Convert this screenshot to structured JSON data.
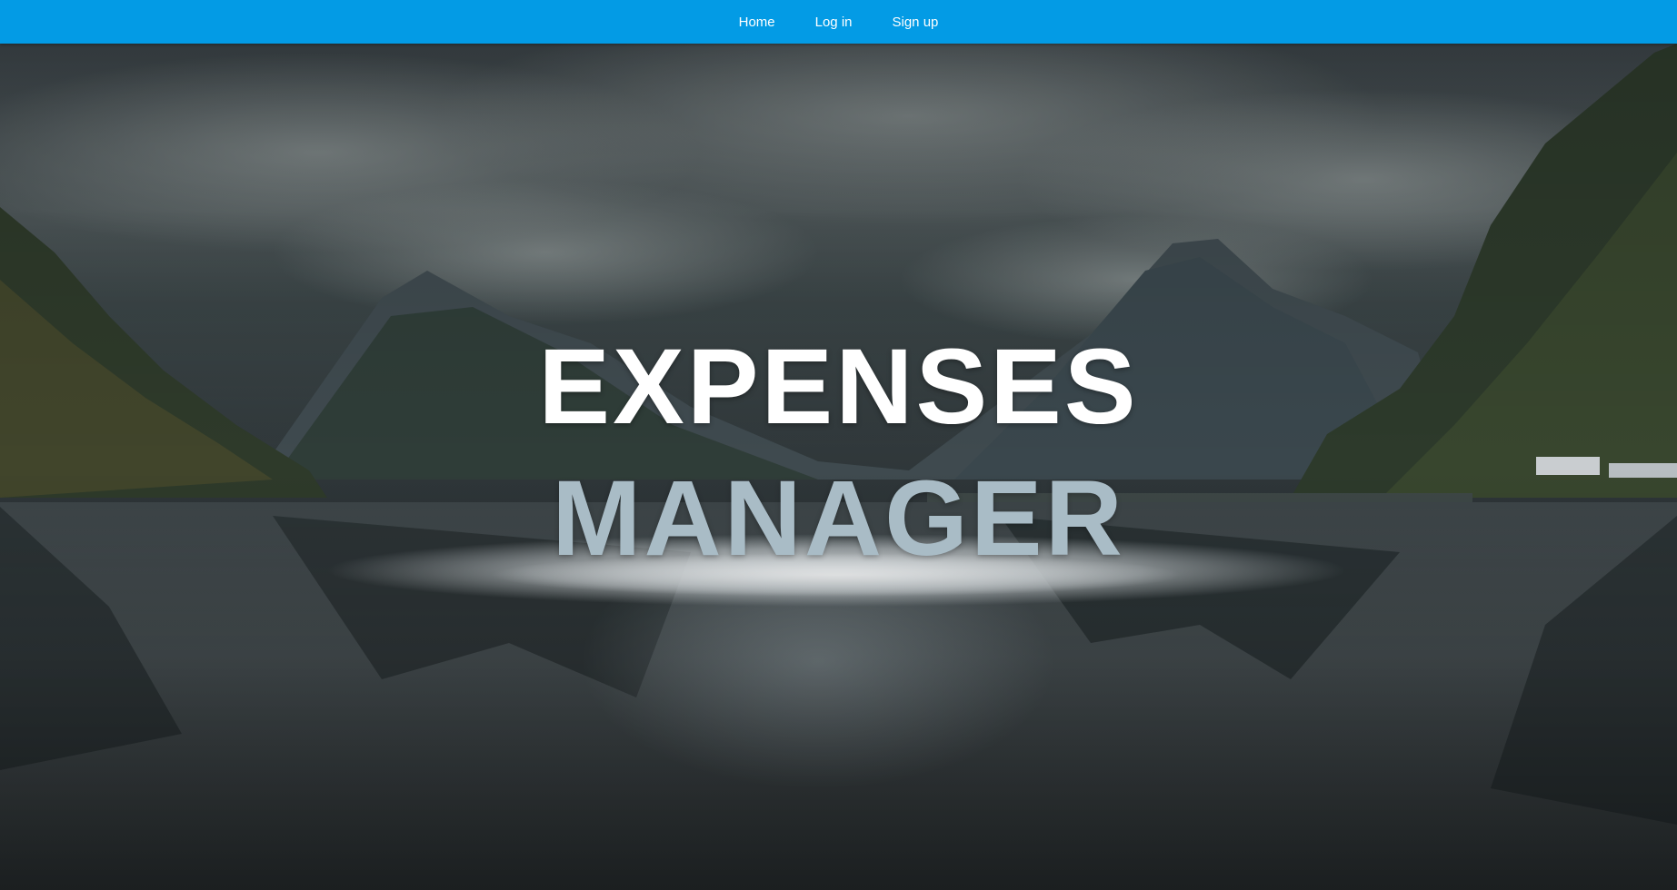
{
  "nav": {
    "items": [
      {
        "label": "Home"
      },
      {
        "label": "Log in"
      },
      {
        "label": "Sign up"
      }
    ],
    "background": "#039be5",
    "text_color": "#ffffff"
  },
  "hero": {
    "line1": "EXPENSES",
    "line2": "MANAGER",
    "line1_color": "#ffffff",
    "line2_color": "#a9bcc6",
    "background_image": "misty-fjord-landscape"
  }
}
